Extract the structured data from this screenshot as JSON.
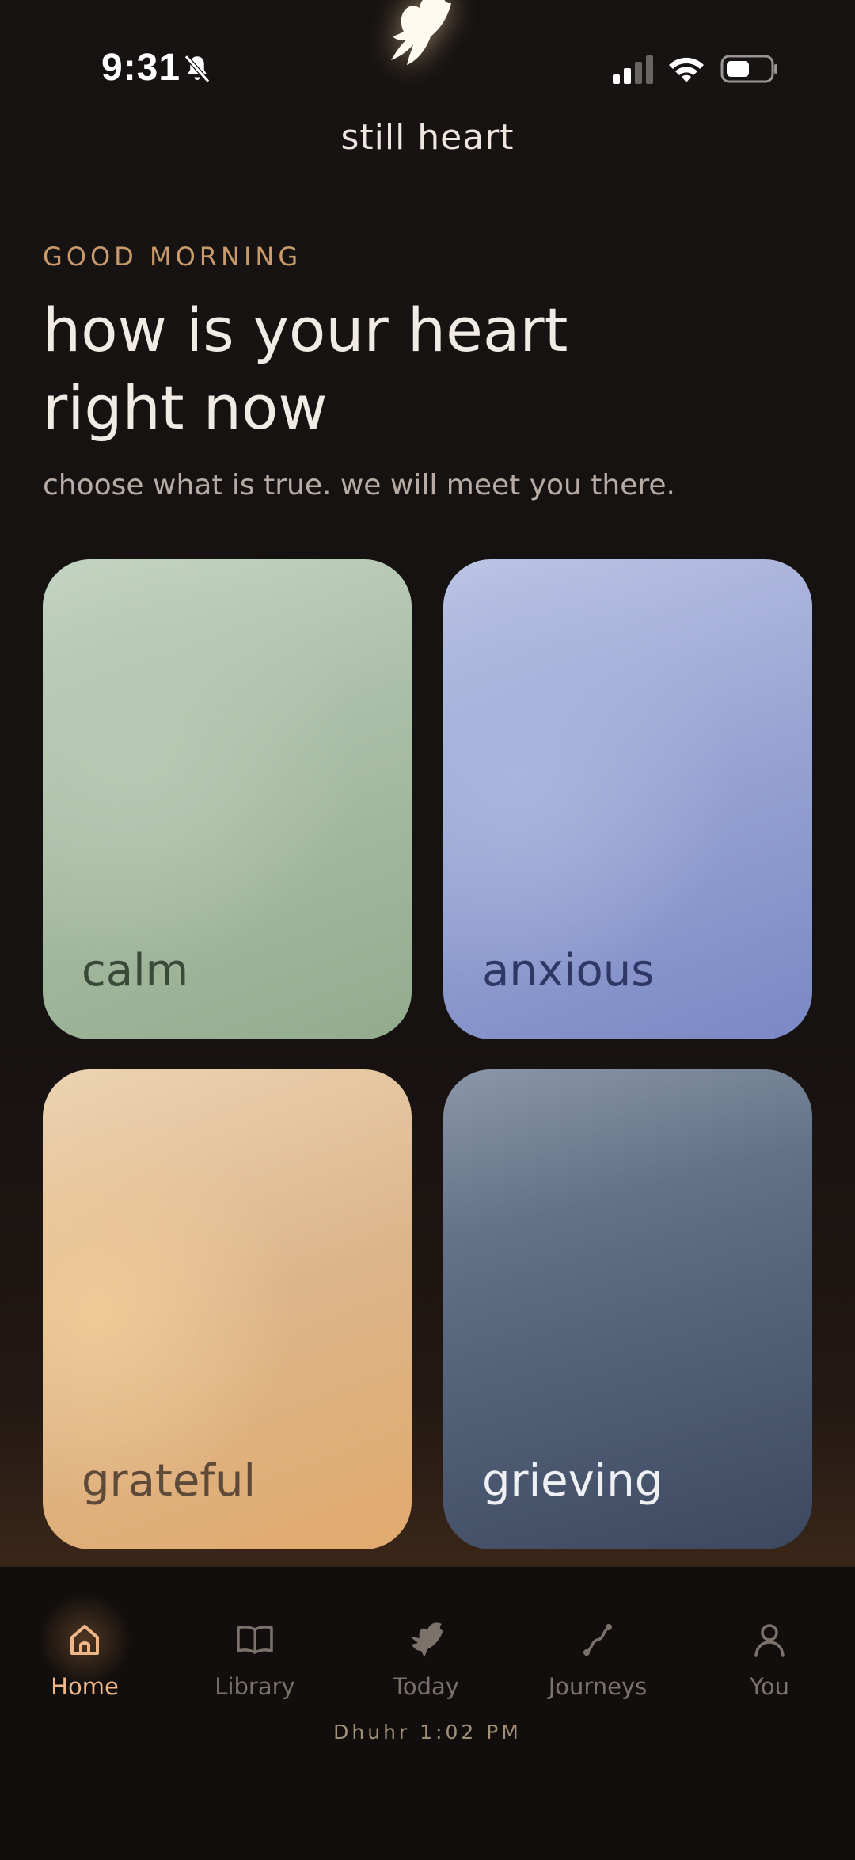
{
  "status_bar": {
    "time": "9:31",
    "icons": [
      "bell-slash-icon",
      "signal-icon",
      "wifi-icon",
      "battery-icon"
    ]
  },
  "header": {
    "logo_icon": "dove-icon",
    "brand": "still heart"
  },
  "greeting": {
    "eyebrow": "GOOD MORNING",
    "headline_line1": "how is your heart",
    "headline_line2": "right now",
    "subline": "choose what is true. we will meet you there."
  },
  "moods": [
    {
      "label": "calm",
      "color": "#a9bea6"
    },
    {
      "label": "anxious",
      "color": "#97a3d3"
    },
    {
      "label": "grateful",
      "color": "#dcb58a"
    },
    {
      "label": "grieving",
      "color": "#4e5c74"
    }
  ],
  "nav": {
    "items": [
      {
        "label": "Home",
        "icon": "home-icon",
        "active": true
      },
      {
        "label": "Library",
        "icon": "book-icon",
        "active": false
      },
      {
        "label": "Today",
        "icon": "dove-icon",
        "active": false
      },
      {
        "label": "Journeys",
        "icon": "path-icon",
        "active": false
      },
      {
        "label": "You",
        "icon": "person-icon",
        "active": false
      }
    ]
  },
  "prayer_time": "Dhuhr 1:02 PM",
  "colors": {
    "accent": "#efb788",
    "eyebrow": "#c99a6c",
    "background": "#141110"
  }
}
